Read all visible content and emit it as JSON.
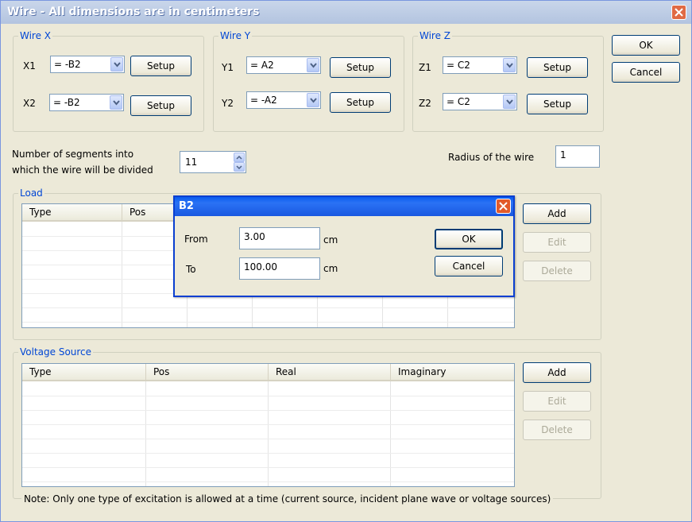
{
  "window": {
    "title": "Wire - All dimensions are in centimeters"
  },
  "wire_x": {
    "legend": "Wire X",
    "x1_label": "X1",
    "x1_value": "= -B2",
    "x2_label": "X2",
    "x2_value": "= -B2",
    "setup_label": "Setup"
  },
  "wire_y": {
    "legend": "Wire Y",
    "y1_label": "Y1",
    "y1_value": "= A2",
    "y2_label": "Y2",
    "y2_value": "= -A2",
    "setup_label": "Setup"
  },
  "wire_z": {
    "legend": "Wire Z",
    "z1_label": "Z1",
    "z1_value": "= C2",
    "z2_label": "Z2",
    "z2_value": "= C2",
    "setup_label": "Setup"
  },
  "main_buttons": {
    "ok": "OK",
    "cancel": "Cancel"
  },
  "segments": {
    "label_line1": "Number of segments into",
    "label_line2": "which the wire will be divided",
    "value": "11"
  },
  "radius": {
    "label": "Radius of the wire",
    "value": "1"
  },
  "load": {
    "legend": "Load",
    "columns": [
      "Type",
      "Pos"
    ],
    "add": "Add",
    "edit": "Edit",
    "delete": "Delete"
  },
  "voltage_source": {
    "legend": "Voltage Source",
    "columns": [
      "Type",
      "Pos",
      "Real",
      "Imaginary"
    ],
    "add": "Add",
    "edit": "Edit",
    "delete": "Delete"
  },
  "note": "Note: Only one type of excitation is allowed at a time (current source, incident plane wave or voltage sources)",
  "dialog": {
    "title": "B2",
    "from_label": "From",
    "from_value": "3.00",
    "to_label": "To",
    "to_value": "100.00",
    "unit": "cm",
    "ok": "OK",
    "cancel": "Cancel"
  },
  "icons": {
    "close": "close-icon",
    "dropdown": "chevron-down-icon",
    "spin_up": "chevron-up-icon",
    "spin_down": "chevron-down-icon"
  }
}
